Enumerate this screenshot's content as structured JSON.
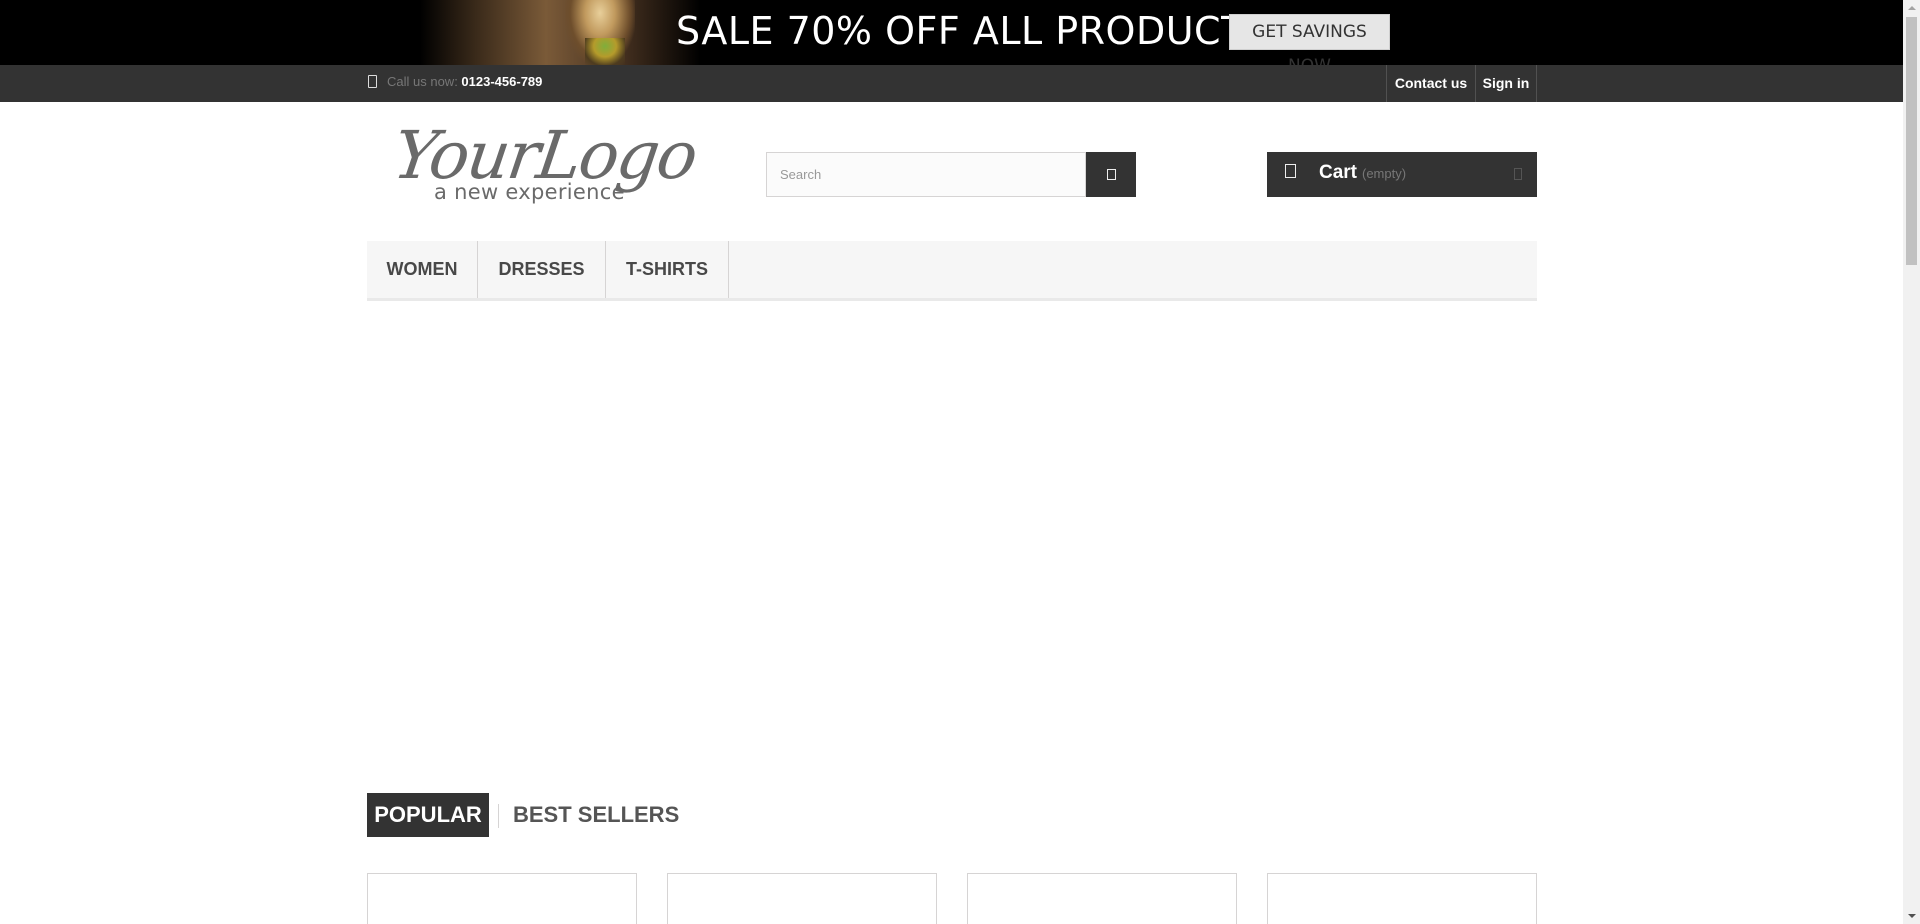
{
  "banner": {
    "text": "SALE 70% OFF ALL PRODUCTS",
    "button_label": "GET SAVINGS NOW"
  },
  "nav": {
    "call_label": "Call us now: ",
    "phone": "0123-456-789",
    "contact_label": "Contact us",
    "signin_label": "Sign in"
  },
  "header": {
    "logo_main": "YourLogo",
    "logo_sub": "a new experience",
    "search_placeholder": "Search",
    "cart_label": "Cart",
    "cart_status": "(empty)"
  },
  "menu": {
    "items": [
      {
        "label": "WOMEN"
      },
      {
        "label": "DRESSES"
      },
      {
        "label": "T-SHIRTS"
      }
    ]
  },
  "tabs": {
    "popular": "POPULAR",
    "best_sellers": "BEST SELLERS"
  },
  "colors": {
    "dark": "#333333",
    "banner_bg": "#000000",
    "menu_bg": "#f6f6f6"
  },
  "icons": {
    "phone": "phone-icon",
    "search": "search-icon",
    "cart": "cart-icon",
    "chevron": "chevron-down-icon"
  }
}
